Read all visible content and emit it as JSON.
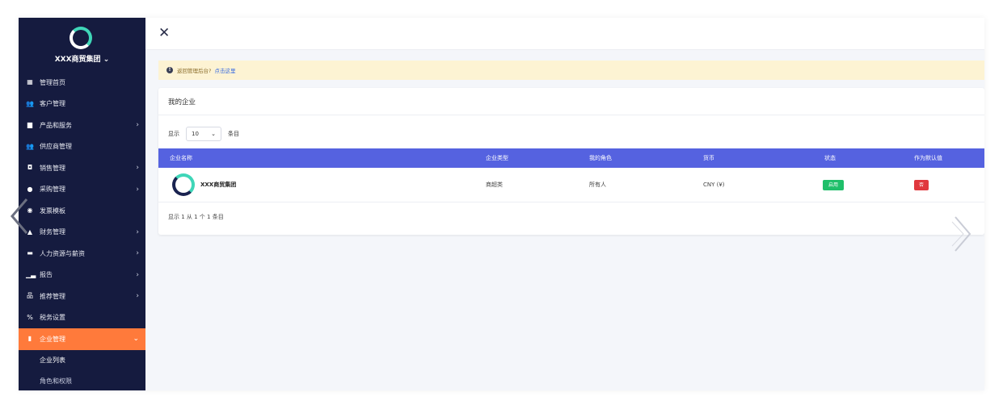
{
  "sidebar": {
    "company_switch": "XXX商贸集团",
    "items": [
      {
        "label": "管理首页",
        "icon": "dashboard-icon",
        "glyph": "▦",
        "chevron": false
      },
      {
        "label": "客户管理",
        "icon": "users-icon",
        "glyph": "👥",
        "chevron": false
      },
      {
        "label": "产品和服务",
        "icon": "briefcase-icon",
        "glyph": "▆",
        "chevron": true
      },
      {
        "label": "供应商管理",
        "icon": "users-icon",
        "glyph": "👥",
        "chevron": false
      },
      {
        "label": "销售管理",
        "icon": "gift-icon",
        "glyph": "◘",
        "chevron": true
      },
      {
        "label": "采购管理",
        "icon": "bag-icon",
        "glyph": "●",
        "chevron": true
      },
      {
        "label": "发票模板",
        "icon": "palette-icon",
        "glyph": "◉",
        "chevron": false
      },
      {
        "label": "财务管理",
        "icon": "bank-icon",
        "glyph": "▲",
        "chevron": true
      },
      {
        "label": "人力资源与薪资",
        "icon": "id-card-icon",
        "glyph": "▬",
        "chevron": true
      },
      {
        "label": "报告",
        "icon": "chart-icon",
        "glyph": "▁▃",
        "chevron": true
      },
      {
        "label": "推荐管理",
        "icon": "sitemap-icon",
        "glyph": "品",
        "chevron": true
      },
      {
        "label": "税务设置",
        "icon": "percent-icon",
        "glyph": "%",
        "chevron": false
      },
      {
        "label": "企业管理",
        "icon": "building-icon",
        "glyph": "▮",
        "chevron": true,
        "active": true
      }
    ],
    "sub_items": [
      "企业列表",
      "角色和权限"
    ]
  },
  "alert": {
    "text": "返回管理后台?",
    "link": "点击这里"
  },
  "card": {
    "title": "我的企业",
    "length_prefix": "显示",
    "length_value": "10",
    "length_suffix": "条目",
    "columns": [
      "企业名称",
      "企业类型",
      "我的角色",
      "货币",
      "状态",
      "作为默认值"
    ],
    "rows": [
      {
        "name": "XXX商贸集团",
        "type": "商超类",
        "role": "所有人",
        "currency": "CNY (¥)",
        "status": "启用",
        "default": "否"
      }
    ],
    "info": "显示 1 从 1 个 1 条目"
  },
  "colors": {
    "sidebar_bg": "#151b3f",
    "accent": "#ff7a3b",
    "table_header": "#5562e0",
    "status_green": "#1fbf6a",
    "default_red": "#e0383e"
  }
}
